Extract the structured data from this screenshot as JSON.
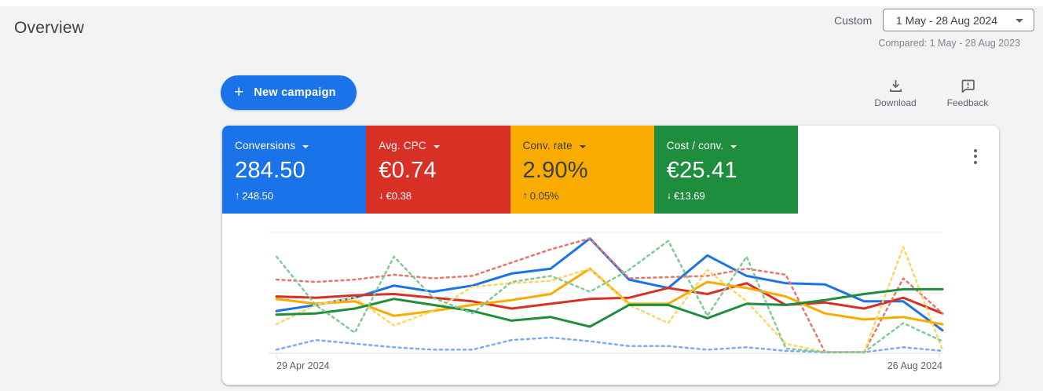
{
  "page": {
    "title": "Overview"
  },
  "date_selector": {
    "label": "Custom",
    "range": "1 May - 28 Aug 2024",
    "compared": "Compared: 1 May - 28 Aug 2023"
  },
  "toolbar": {
    "new_campaign": "New campaign",
    "plus_glyph": "+",
    "download": "Download",
    "feedback": "Feedback"
  },
  "colors": {
    "accent_blue": "#1a73e8",
    "page_bg": "#f1f3f4",
    "card_bg": "#ffffff",
    "scorecard_blue": "#1a73e8",
    "scorecard_red": "#d93025",
    "scorecard_yellow": "#f9ab00",
    "scorecard_green": "#1e8e3e"
  },
  "scorecards": [
    {
      "label": "Conversions",
      "value": "284.50",
      "delta_arrow": "↑",
      "delta_value": "248.50",
      "color": "#1a73e8",
      "text_color": "#ffffff"
    },
    {
      "label": "Avg. CPC",
      "value": "€0.74",
      "delta_arrow": "↓",
      "delta_value": "€0.38",
      "color": "#d93025",
      "text_color": "#ffffff"
    },
    {
      "label": "Conv. rate",
      "value": "2.90%",
      "delta_arrow": "↑",
      "delta_value": "0.05%",
      "color": "#f9ab00",
      "text_color": "#3c4043"
    },
    {
      "label": "Cost / conv.",
      "value": "€25.41",
      "delta_arrow": "↓",
      "delta_value": "€13.69",
      "color": "#1e8e3e",
      "text_color": "#ffffff"
    }
  ],
  "chart_data": {
    "type": "line",
    "title": "",
    "xlabel": "",
    "ylabel": "",
    "x_axis": {
      "start_label": "29 Apr 2024",
      "end_label": "26 Aug 2024",
      "points": 18,
      "interval": "weekly"
    },
    "y_axis": {
      "tick_labels_visible": false,
      "normalized_range": [
        0,
        100
      ],
      "gridlines_at": [
        0,
        50,
        100
      ]
    },
    "legend": "none",
    "ylim": [
      0,
      100
    ],
    "series": [
      {
        "id": "conversions-current",
        "name": "Conversions",
        "period": "1 May - 28 Aug 2024",
        "style": "solid",
        "color": "#1a73e8",
        "values": [
          35,
          40,
          46,
          56,
          51,
          56,
          66,
          70,
          95,
          61,
          54,
          81,
          64,
          58,
          57,
          43,
          43,
          19
        ]
      },
      {
        "id": "conversions-previous",
        "name": "Conversions",
        "period": "1 May - 28 Aug 2023",
        "style": "dashed",
        "color": "#7baaf7",
        "values": [
          3,
          11,
          8,
          5,
          3,
          3,
          11,
          13,
          10,
          6,
          6,
          3,
          5,
          2,
          1,
          1,
          5,
          2
        ]
      },
      {
        "id": "avg-cpc-current",
        "name": "Avg. CPC",
        "period": "1 May - 28 Aug 2024",
        "style": "solid",
        "color": "#d93025",
        "values": [
          47,
          46,
          48,
          49,
          46,
          43,
          37,
          41,
          45,
          46,
          54,
          49,
          58,
          40,
          42,
          37,
          46,
          33
        ]
      },
      {
        "id": "avg-cpc-previous",
        "name": "Avg. CPC",
        "period": "1 May - 28 Aug 2023",
        "style": "dashed",
        "color": "#e8756c",
        "values": [
          61,
          59,
          61,
          65,
          62,
          64,
          75,
          86,
          95,
          62,
          63,
          64,
          70,
          65,
          1,
          1,
          62,
          33
        ]
      },
      {
        "id": "conv-rate-current",
        "name": "Conv. rate",
        "period": "1 May - 28 Aug 2024",
        "style": "solid",
        "color": "#f9ab00",
        "values": [
          45,
          41,
          43,
          31,
          35,
          40,
          44,
          49,
          70,
          41,
          41,
          59,
          54,
          47,
          33,
          28,
          30,
          24
        ]
      },
      {
        "id": "conv-rate-previous",
        "name": "Conv. rate",
        "period": "1 May - 28 Aug 2023",
        "style": "dashed",
        "color": "#fdd663",
        "values": [
          24,
          40,
          46,
          23,
          35,
          55,
          58,
          60,
          70,
          40,
          25,
          69,
          43,
          8,
          1,
          1,
          88,
          3
        ]
      },
      {
        "id": "cost-conv-current",
        "name": "Cost / conv.",
        "period": "1 May - 28 Aug 2024",
        "style": "solid",
        "color": "#1e8e3e",
        "values": [
          32,
          33,
          37,
          45,
          40,
          35,
          27,
          30,
          22,
          40,
          40,
          29,
          41,
          40,
          44,
          49,
          53,
          53
        ]
      },
      {
        "id": "cost-conv-previous",
        "name": "Cost / conv.",
        "period": "1 May - 28 Aug 2023",
        "style": "dashed",
        "color": "#81c995",
        "values": [
          80,
          40,
          17,
          80,
          46,
          33,
          59,
          64,
          51,
          69,
          93,
          31,
          80,
          4,
          1,
          1,
          25,
          10
        ]
      }
    ]
  }
}
